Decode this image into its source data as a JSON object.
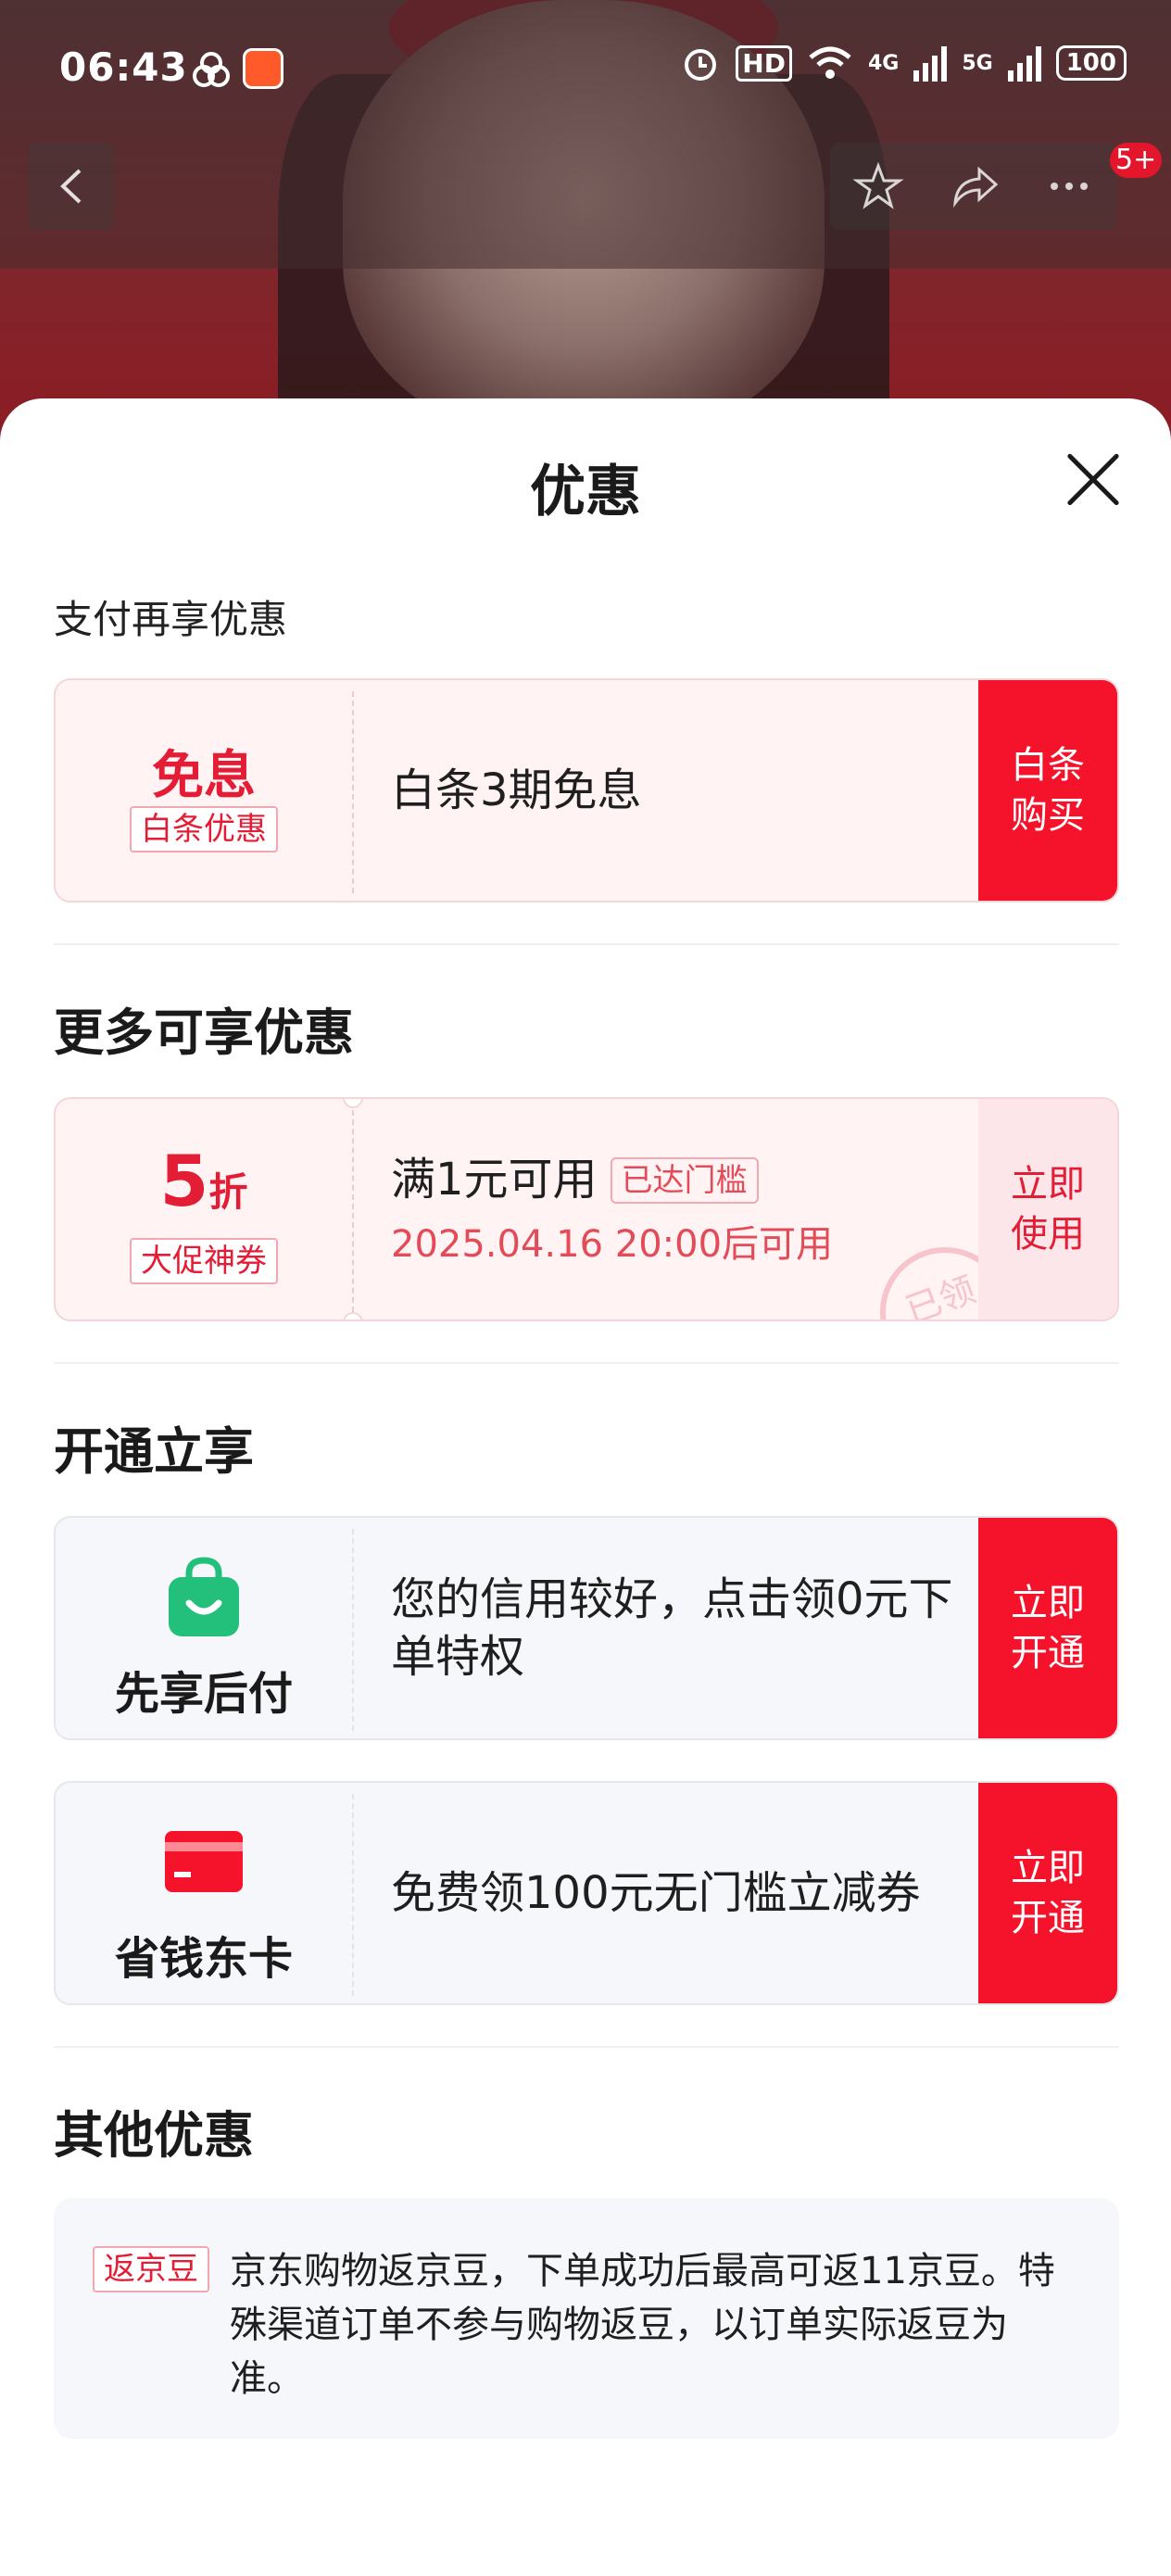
{
  "status_bar": {
    "time": "06:43",
    "hd": "HD",
    "battery": "100",
    "network1": "4G",
    "network2": "5G"
  },
  "nav": {
    "badge": "5+"
  },
  "sheet": {
    "title": "优惠",
    "section1": {
      "heading": "支付再享优惠",
      "card": {
        "left_big": "免息",
        "left_tag": "白条优惠",
        "main": "白条3期免息",
        "action_line1": "白条",
        "action_line2": "购买"
      }
    },
    "section2": {
      "heading": "更多可享优惠",
      "card": {
        "discount_num": "5",
        "discount_unit": "折",
        "left_tag": "大促神券",
        "main": "满1元可用",
        "threshold_tag": "已达门槛",
        "validity": "2025.04.16 20:00后可用",
        "stamp": "已领",
        "action_line1": "立即",
        "action_line2": "使用"
      }
    },
    "section3": {
      "heading": "开通立享",
      "cards": [
        {
          "label": "先享后付",
          "main": "您的信用较好，点击领0元下单特权",
          "action_line1": "立即",
          "action_line2": "开通"
        },
        {
          "label": "省钱东卡",
          "main": "免费领100元无门槛立减券",
          "action_line1": "立即",
          "action_line2": "开通"
        }
      ]
    },
    "section4": {
      "heading": "其他优惠",
      "tag": "返京豆",
      "text": "京东购物返京豆，下单成功后最高可返11京豆。特殊渠道订单不参与购物返豆，以订单实际返豆为准。"
    }
  },
  "colors": {
    "accent_red": "#f5122b",
    "pink_bg": "#fff3f4",
    "green_icon": "#22c07a"
  }
}
